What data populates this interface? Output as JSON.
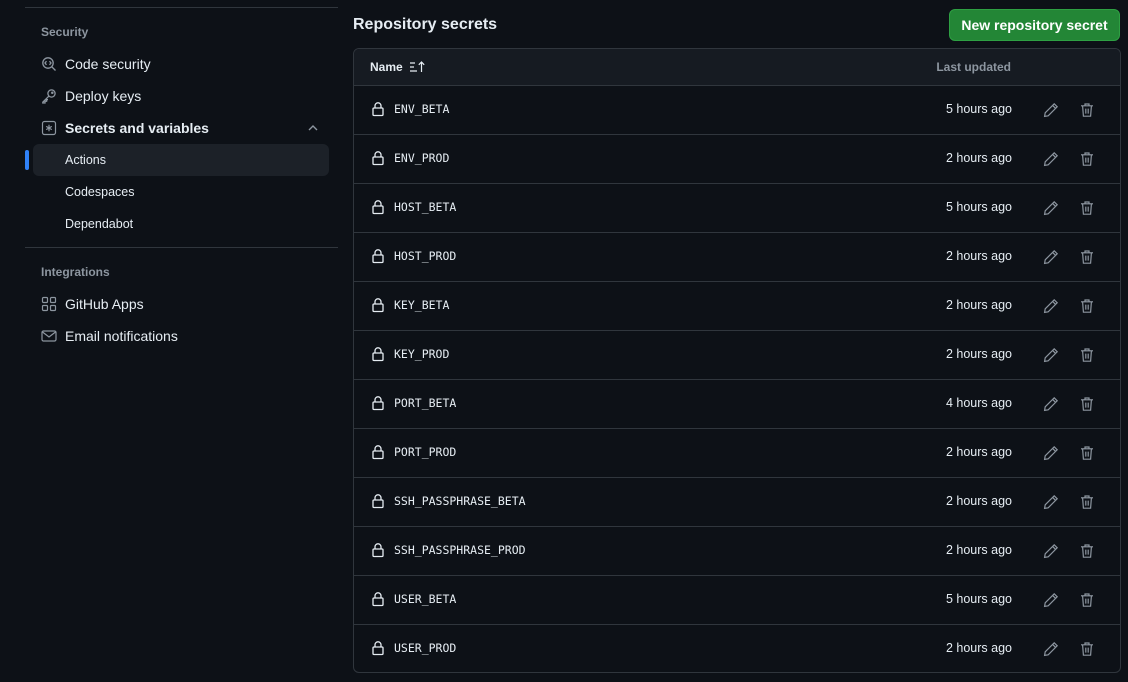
{
  "sidebar": {
    "security_heading": "Security",
    "integrations_heading": "Integrations",
    "items": [
      {
        "label": "Code security",
        "icon": "codescan-icon"
      },
      {
        "label": "Deploy keys",
        "icon": "key-icon"
      },
      {
        "label": "Secrets and variables",
        "icon": "asterisk-icon"
      }
    ],
    "sub_items": [
      {
        "label": "Actions",
        "active": true
      },
      {
        "label": "Codespaces",
        "active": false
      },
      {
        "label": "Dependabot",
        "active": false
      }
    ],
    "integration_items": [
      {
        "label": "GitHub Apps",
        "icon": "apps-icon"
      },
      {
        "label": "Email notifications",
        "icon": "mail-icon"
      }
    ]
  },
  "main": {
    "title": "Repository secrets",
    "new_button_label": "New repository secret",
    "table": {
      "col_name": "Name",
      "col_updated": "Last updated",
      "rows": [
        {
          "name": "ENV_BETA",
          "updated": "5 hours ago"
        },
        {
          "name": "ENV_PROD",
          "updated": "2 hours ago"
        },
        {
          "name": "HOST_BETA",
          "updated": "5 hours ago"
        },
        {
          "name": "HOST_PROD",
          "updated": "2 hours ago"
        },
        {
          "name": "KEY_BETA",
          "updated": "2 hours ago"
        },
        {
          "name": "KEY_PROD",
          "updated": "2 hours ago"
        },
        {
          "name": "PORT_BETA",
          "updated": "4 hours ago"
        },
        {
          "name": "PORT_PROD",
          "updated": "2 hours ago"
        },
        {
          "name": "SSH_PASSPHRASE_BETA",
          "updated": "2 hours ago"
        },
        {
          "name": "SSH_PASSPHRASE_PROD",
          "updated": "2 hours ago"
        },
        {
          "name": "USER_BETA",
          "updated": "5 hours ago"
        },
        {
          "name": "USER_PROD",
          "updated": "2 hours ago"
        }
      ]
    }
  },
  "colors": {
    "background": "#0d1117",
    "border": "#30363d",
    "header_bg": "#161b22",
    "accent_active": "#2f81f7",
    "primary_button": "#238636",
    "muted_text": "#8d96a0"
  }
}
